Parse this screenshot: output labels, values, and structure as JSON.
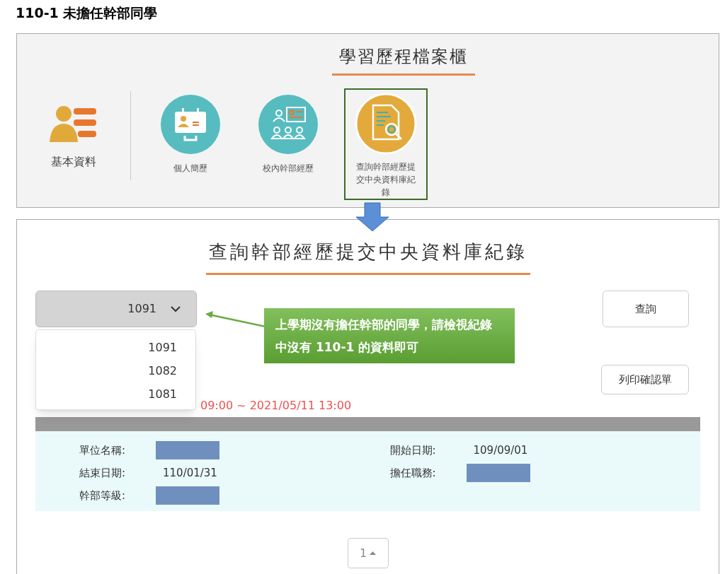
{
  "page_title": "110-1 未擔任幹部同學",
  "portfolio": {
    "heading": "學習歷程檔案櫃",
    "basic": {
      "label": "基本資料"
    },
    "tiles": [
      {
        "label": "個人簡歷",
        "kind": "resume",
        "selected": false
      },
      {
        "label": "校內幹部經歷",
        "kind": "cadre",
        "selected": false
      },
      {
        "label": "查詢幹部經歷提交中央資料庫紀錄",
        "kind": "query",
        "selected": true
      }
    ]
  },
  "query_panel": {
    "heading": "查詢幹部經歷提交中央資料庫紀錄",
    "year_select": {
      "value": "1091",
      "options": [
        "1091",
        "1082",
        "1081"
      ]
    },
    "query_button": "查詢",
    "print_button": "列印確認單",
    "callout": "上學期沒有擔任幹部的同學，請檢視紀錄中沒有 110-1 的資料即可",
    "period": "09:00 ~ 2021/05/11 13:00",
    "record": {
      "fields": [
        {
          "label": "單位名稱:",
          "kind": "redacted"
        },
        {
          "label": "開始日期:",
          "kind": "text",
          "value": "109/09/01"
        },
        {
          "label": "結束日期:",
          "kind": "text",
          "value": "110/01/31"
        },
        {
          "label": "擔任職務:",
          "kind": "redacted"
        },
        {
          "label": "幹部等級:",
          "kind": "redacted"
        }
      ]
    },
    "pagination": {
      "page": "1"
    }
  }
}
